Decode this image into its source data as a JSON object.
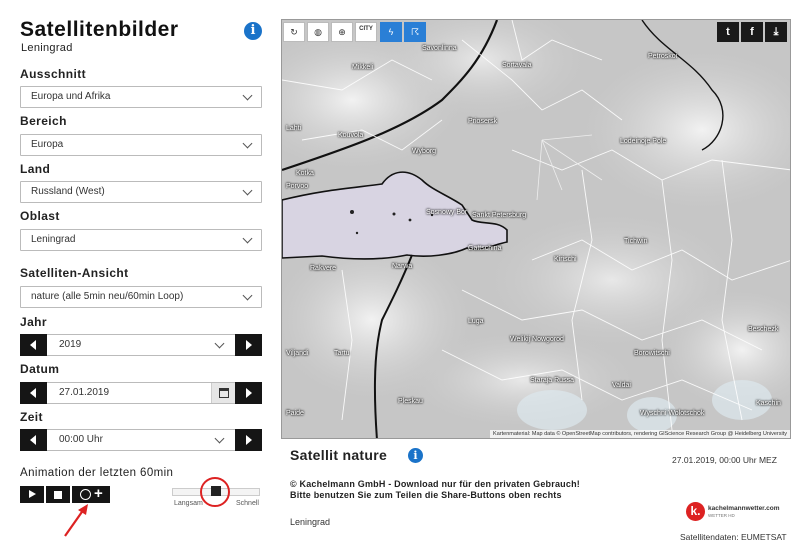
{
  "page": {
    "title": "Satellitenbilder",
    "subtitle": "Leningrad"
  },
  "form": {
    "ausschnitt": {
      "label": "Ausschnitt",
      "value": "Europa und Afrika"
    },
    "bereich": {
      "label": "Bereich",
      "value": "Europa"
    },
    "land": {
      "label": "Land",
      "value": "Russland (West)"
    },
    "oblast": {
      "label": "Oblast",
      "value": "Leningrad"
    },
    "ansicht": {
      "label": "Satelliten-Ansicht",
      "value": "nature  (alle 5min neu/60min Loop)"
    },
    "jahr": {
      "label": "Jahr",
      "value": "2019"
    },
    "datum": {
      "label": "Datum",
      "value": "27.01.2019"
    },
    "zeit": {
      "label": "Zeit",
      "value": "00:00 Uhr"
    }
  },
  "animation": {
    "title": "Animation der letzten 60min",
    "slow_label": "Langsam",
    "fast_label": "Schnell",
    "speed_level": 0.5
  },
  "map": {
    "toolbar": [
      "refresh-icon",
      "globe-icon",
      "zoom-icon",
      "city-toggle",
      "lightning-icon",
      "wind-icon"
    ],
    "city_button_label": "CITY",
    "share": [
      "twitter-icon",
      "facebook-icon",
      "download-icon"
    ],
    "cities": [
      "Savonlinna",
      "Sortavala",
      "Petroskoi",
      "Mikkeli",
      "Lahti",
      "Kouvola",
      "Wyborg",
      "Priosersk",
      "Lodeinoje Pole",
      "Kotka",
      "Porvoo",
      "Sosnowy Bor",
      "Sankt Petersburg",
      "Gattschina",
      "Tichwin",
      "Kirischi",
      "Narwa",
      "Rakvere",
      "Luga",
      "Welikij Nowgorod",
      "Borowitschi",
      "Tartu",
      "Viljandi",
      "Staraja Russa",
      "Valdai",
      "Pleskau",
      "Wyschni Wolotschok",
      "Beschezk",
      "Kaschin",
      "Paide",
      "Tallinn"
    ],
    "attribution": "Kartenmaterial: Map data © OpenStreetMap contributors, rendering GIScience Research Group @ Heidelberg University"
  },
  "info": {
    "title": "Satellit nature",
    "timestamp": "27.01.2019, 00:00 Uhr MEZ",
    "copyright": "© Kachelmann GmbH - Download nur für den privaten Gebrauch!",
    "share_hint": "Bitte benutzen Sie zum Teilen die Share-Buttons oben rechts",
    "region": "Leningrad",
    "logo_text": "kachelmannwetter.com",
    "logo_sub": "WETTER HD",
    "logo_letter": "k.",
    "satdata": "Satellitendaten: EUMETSAT"
  },
  "colors": {
    "accent": "#1a73c9",
    "highlight": "#dd2222",
    "dark_button": "#151515"
  }
}
